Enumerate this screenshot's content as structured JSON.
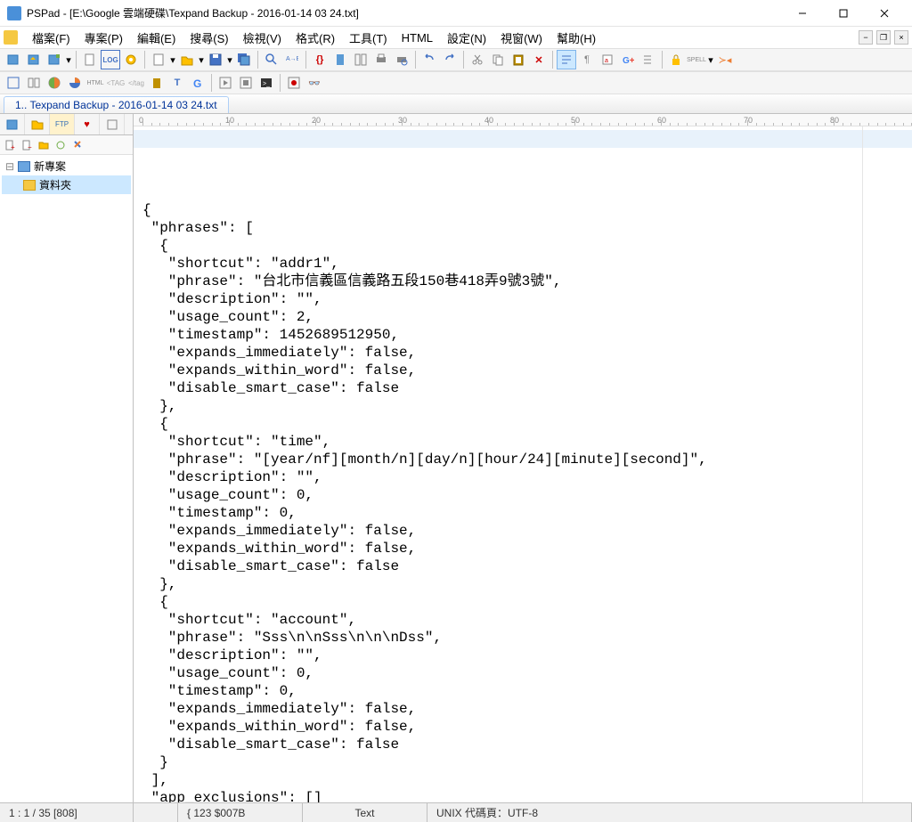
{
  "title": "PSPad - [E:\\Google 雲端硬碟\\Texpand Backup - 2016-01-14 03 24.txt]",
  "menu": {
    "file": "檔案(F)",
    "project": "專案(P)",
    "edit": "編輯(E)",
    "search": "搜尋(S)",
    "view": "檢視(V)",
    "format": "格式(R)",
    "tools": "工具(T)",
    "html": "HTML",
    "settings": "設定(N)",
    "window": "視窗(W)",
    "help": "幫助(H)"
  },
  "tab": {
    "label": "1.. Texpand Backup - 2016-01-14 03 24.txt"
  },
  "sidebar": {
    "project": "新專案",
    "folder": "資料夾"
  },
  "ruler": {
    "marks": [
      "0",
      "10",
      "20",
      "30",
      "40",
      "50",
      "60",
      "70",
      "80"
    ]
  },
  "code": "{\n \"phrases\": [\n  {\n   \"shortcut\": \"addr1\",\n   \"phrase\": \"台北市信義區信義路五段150巷418弄9號3號\",\n   \"description\": \"\",\n   \"usage_count\": 2,\n   \"timestamp\": 1452689512950,\n   \"expands_immediately\": false,\n   \"expands_within_word\": false,\n   \"disable_smart_case\": false\n  },\n  {\n   \"shortcut\": \"time\",\n   \"phrase\": \"[year/nf][month/n][day/n][hour/24][minute][second]\",\n   \"description\": \"\",\n   \"usage_count\": 0,\n   \"timestamp\": 0,\n   \"expands_immediately\": false,\n   \"expands_within_word\": false,\n   \"disable_smart_case\": false\n  },\n  {\n   \"shortcut\": \"account\",\n   \"phrase\": \"Sss\\n\\nSss\\n\\n\\nDss\",\n   \"description\": \"\",\n   \"usage_count\": 0,\n   \"timestamp\": 0,\n   \"expands_immediately\": false,\n   \"expands_within_word\": false,\n   \"disable_smart_case\": false\n  }\n ],\n \"app_exclusions\": []\n}",
  "status": {
    "pos": "1 : 1 / 35  [808]",
    "char": "{  123  $007B",
    "mode": "Text",
    "enc": "UNIX  代碼頁：UTF-8"
  }
}
